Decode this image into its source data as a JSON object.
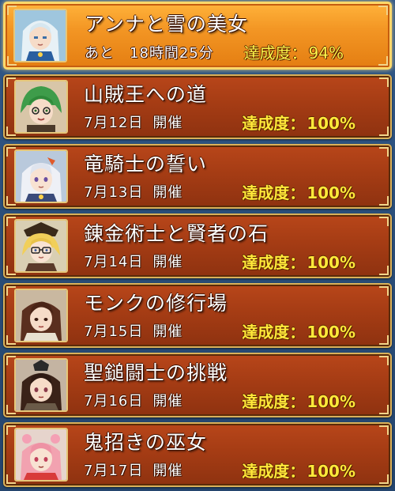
{
  "events": [
    {
      "title": "アンナと雪の美女",
      "date_prefix": "あと",
      "date": "18時間25分",
      "held": "",
      "progress_label": "達成度：",
      "progress": "94%",
      "portrait": "silver-haired-maiden-portrait-icon",
      "active": true
    },
    {
      "title": "山賊王への道",
      "date_prefix": "",
      "date": "7月12日",
      "held": "開催",
      "progress_label": "達成度：",
      "progress": "100%",
      "portrait": "green-haired-girl-portrait-icon",
      "active": false
    },
    {
      "title": "竜騎士の誓い",
      "date_prefix": "",
      "date": "7月13日",
      "held": "開催",
      "progress_label": "達成度：",
      "progress": "100%",
      "portrait": "silver-haired-knight-portrait-icon",
      "active": false
    },
    {
      "title": "錬金術士と賢者の石",
      "date_prefix": "",
      "date": "7月14日",
      "held": "開催",
      "progress_label": "達成度：",
      "progress": "100%",
      "portrait": "blonde-alchemist-portrait-icon",
      "active": false
    },
    {
      "title": "モンクの修行場",
      "date_prefix": "",
      "date": "7月15日",
      "held": "開催",
      "progress_label": "達成度：",
      "progress": "100%",
      "portrait": "brown-haired-monk-portrait-icon",
      "active": false
    },
    {
      "title": "聖鎚闘士の挑戦",
      "date_prefix": "",
      "date": "7月16日",
      "held": "開催",
      "progress_label": "達成度：",
      "progress": "100%",
      "portrait": "dark-haired-fighter-portrait-icon",
      "active": false
    },
    {
      "title": "鬼招きの巫女",
      "date_prefix": "",
      "date": "7月17日",
      "held": "開催",
      "progress_label": "達成度：",
      "progress": "100%",
      "portrait": "pink-haired-shrine-maiden-portrait-icon",
      "active": false
    }
  ],
  "colors": {
    "active_card": "#f39624",
    "card": "#a53c14",
    "frame_gold": "#d9b15a",
    "progress_text": "#ffe93a",
    "background": "#2a4f7c"
  }
}
